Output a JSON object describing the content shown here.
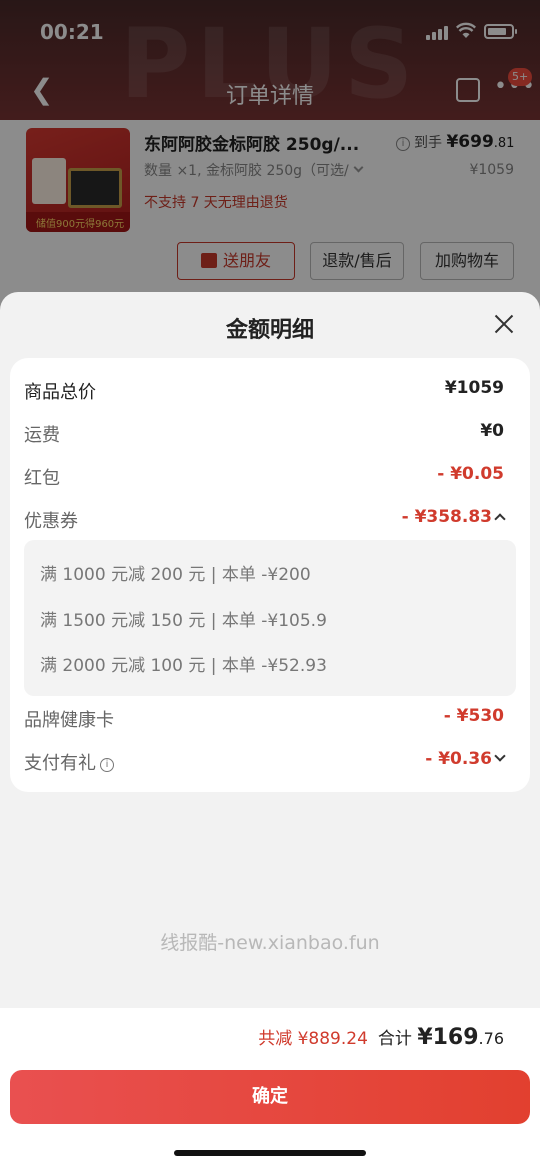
{
  "status": {
    "time": "00:21"
  },
  "nav": {
    "title": "订单详情",
    "badge": "5+"
  },
  "product": {
    "name": "东阿阿胶金标阿胶 250g/...",
    "spec": "数量 ×1, 金标阿胶 250g（可选/",
    "no_return": "不支持 7 天无理由退货",
    "price_label": "到手",
    "price_int": "¥699",
    "price_dec": ".81",
    "orig_price": "¥1059",
    "thumb_text": "储值900元得960元",
    "buttons": {
      "gift": "送朋友",
      "refund": "退款/售后",
      "cart": "加购物车"
    }
  },
  "sheet": {
    "title": "金额明细",
    "rows": {
      "total": {
        "label": "商品总价",
        "value": "¥1059"
      },
      "shipping": {
        "label": "运费",
        "value": "¥0"
      },
      "redpacket": {
        "label": "红包",
        "value": "- ¥0.05"
      },
      "coupon": {
        "label": "优惠券",
        "value": "- ¥358.83"
      },
      "brandcard": {
        "label": "品牌健康卡",
        "value": "- ¥530"
      },
      "paygift": {
        "label": "支付有礼",
        "value": "- ¥0.36"
      }
    },
    "coupons": [
      "满 1000 元减 200 元 | 本单 -¥200",
      "满 1500 元减 150 元 | 本单 -¥105.9",
      "满 2000 元减 100 元 | 本单 -¥52.93"
    ]
  },
  "watermark": "线报酷-new.xianbao.fun",
  "footer": {
    "reduce": "共减 ¥889.24",
    "total_label": "合计",
    "total_int": "¥169",
    "total_dec": ".76",
    "confirm": "确定"
  },
  "colors": {
    "accent": "#d03b2d",
    "confirm_start": "#e95050",
    "confirm_end": "#e2402f"
  }
}
